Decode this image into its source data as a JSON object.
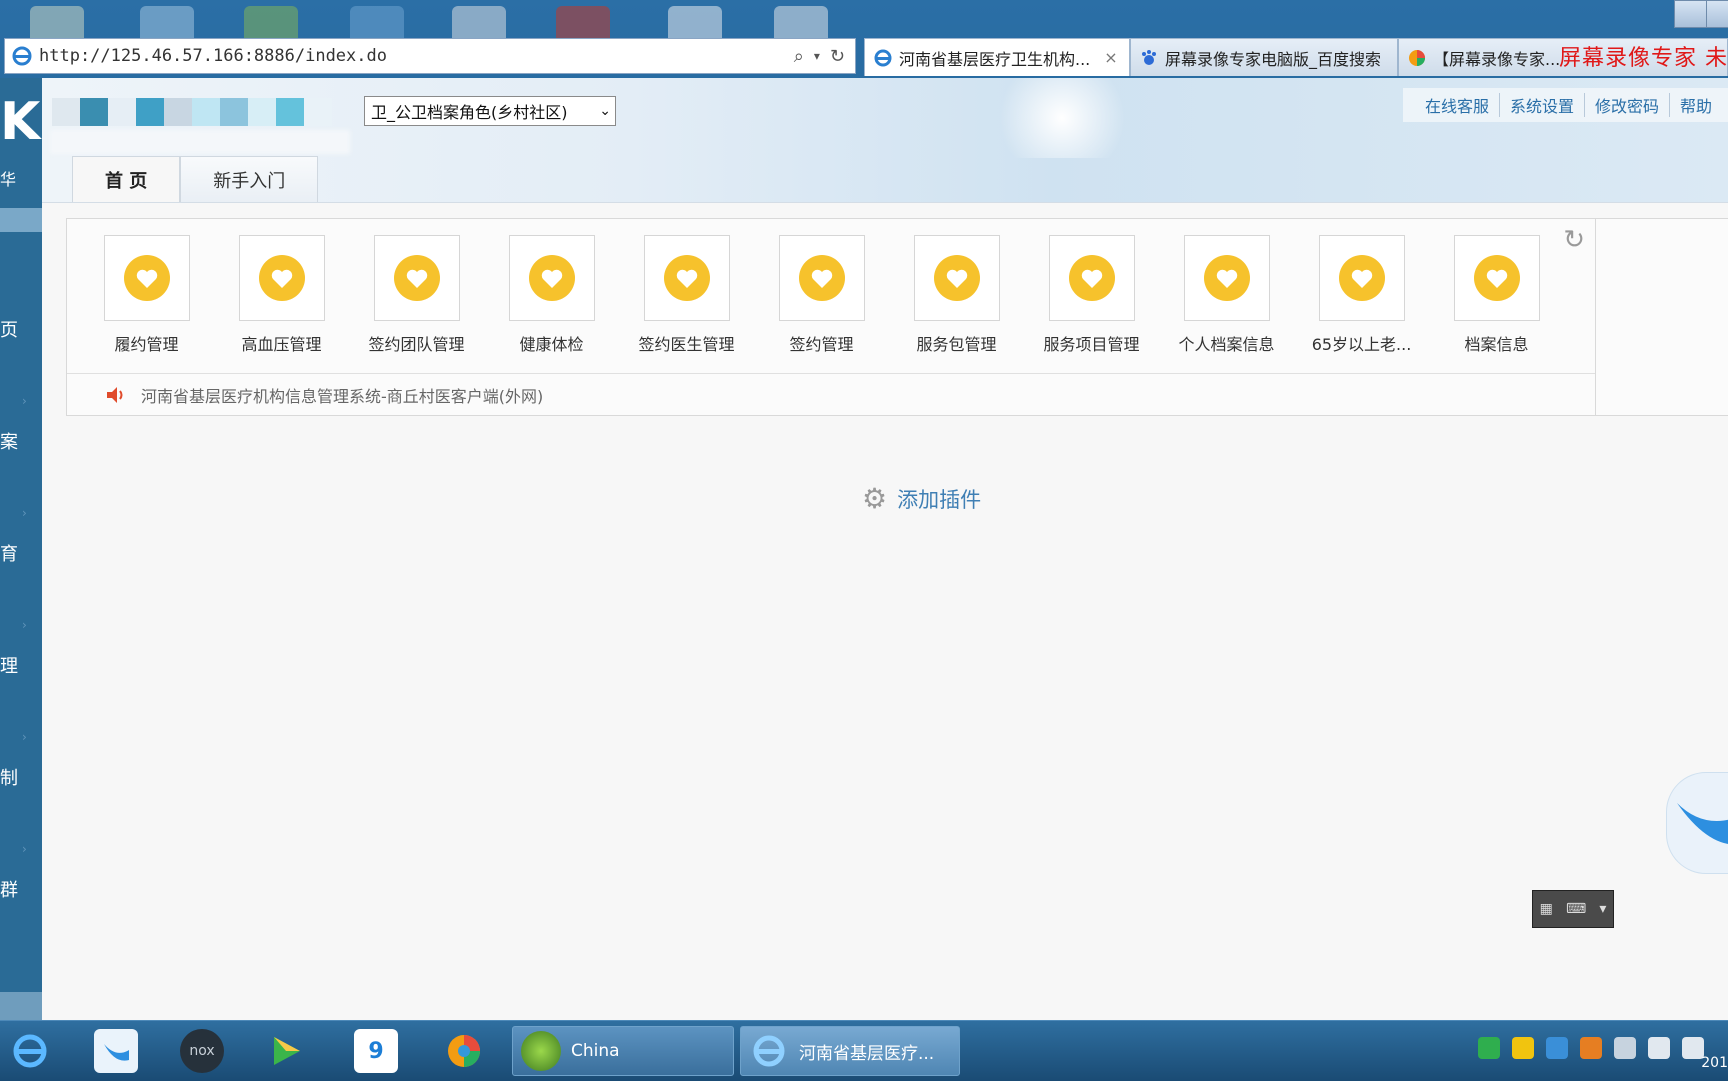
{
  "browser": {
    "address_url": "http://125.46.57.166:8886/index.do",
    "tabs": [
      {
        "label": "河南省基层医疗卫生机构...",
        "close": "×"
      },
      {
        "label": "屏幕录像专家电脑版_百度搜索"
      },
      {
        "label": "【屏幕录像专家..."
      }
    ],
    "watermark": "屏幕录像专家 未"
  },
  "header": {
    "role_select": "卫_公卫档案角色(乡村社区)",
    "links": [
      "在线客服",
      "系统设置",
      "修改密码",
      "帮助"
    ],
    "tabs": [
      "首 页",
      "新手入门"
    ]
  },
  "sidebar": {
    "top_text": "华",
    "items": [
      "页",
      "案",
      "育",
      "理",
      "制",
      "群"
    ]
  },
  "shortcuts": [
    {
      "label": "履约管理"
    },
    {
      "label": "高血压管理"
    },
    {
      "label": "签约团队管理"
    },
    {
      "label": "健康体检"
    },
    {
      "label": "签约医生管理"
    },
    {
      "label": "签约管理"
    },
    {
      "label": "服务包管理"
    },
    {
      "label": "服务项目管理"
    },
    {
      "label": "个人档案信息"
    },
    {
      "label": "65岁以上老..."
    },
    {
      "label": "档案信息"
    }
  ],
  "notice": "河南省基层医疗机构信息管理系统-商丘村医客户端(外网)",
  "add_plugin": "添加插件",
  "taskbar": {
    "tasks": [
      "China",
      "河南省基层医疗..."
    ],
    "clock": "201"
  },
  "colors": {
    "accent": "#2a6fa8",
    "heart": "#f6c22c",
    "sidebar": "#2a6b96",
    "watermark": "#e01818"
  }
}
